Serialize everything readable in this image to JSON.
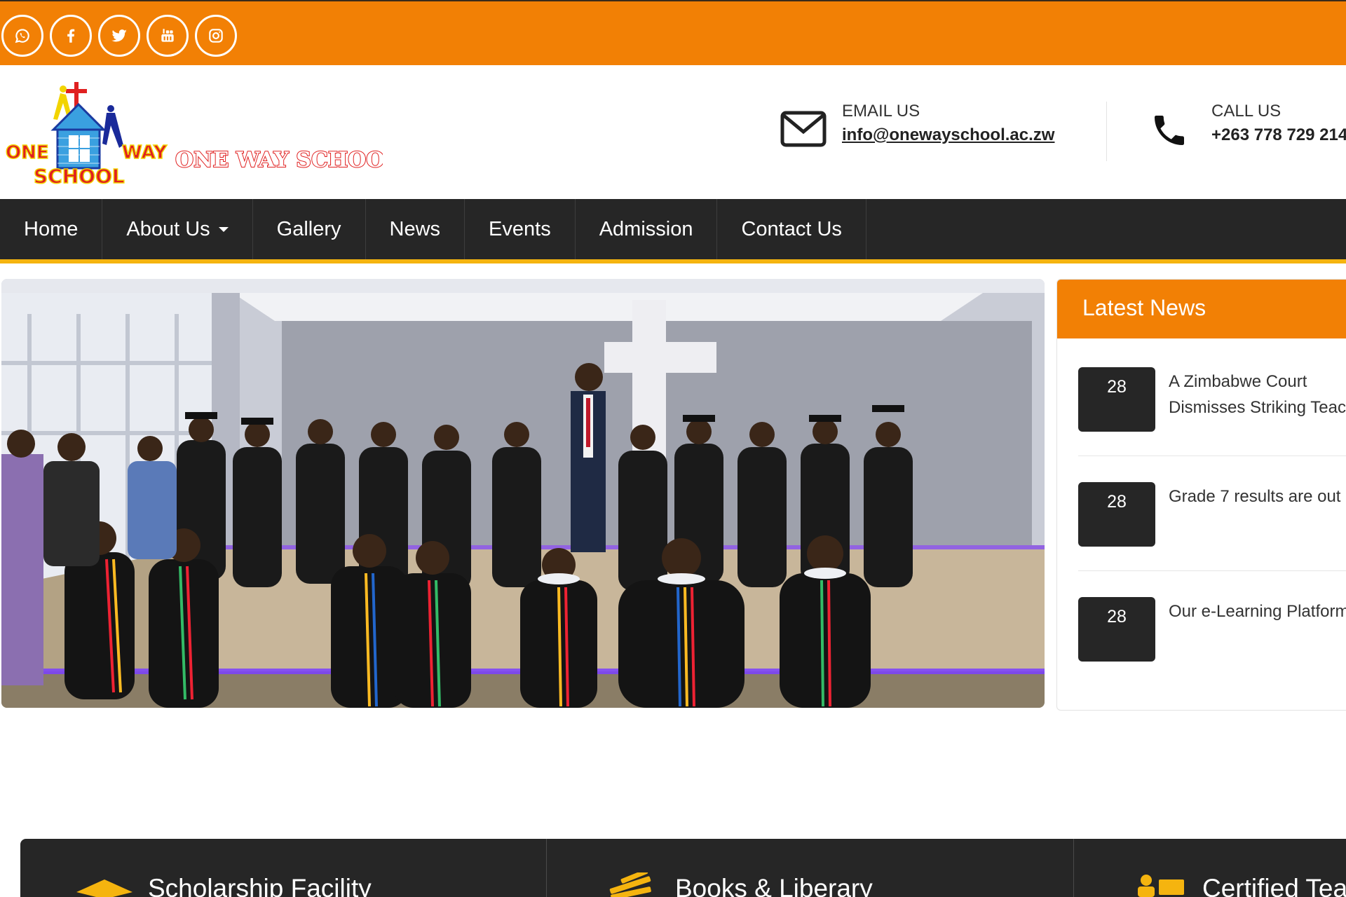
{
  "social": [
    {
      "name": "whatsapp"
    },
    {
      "name": "facebook"
    },
    {
      "name": "twitter"
    },
    {
      "name": "youtube"
    },
    {
      "name": "instagram"
    }
  ],
  "logo": {
    "badge_top": "ONE",
    "badge_right": "WAY",
    "badge_bottom": "SCHOOL",
    "wordmark": "ONE WAY SCHOOL"
  },
  "contact": {
    "email_label": "EMAIL US",
    "email_value": "info@onewayschool.ac.zw",
    "call_label": "CALL US",
    "call_value": "+263 778 729 214"
  },
  "nav": {
    "items": [
      "Home",
      "About Us",
      "Gallery",
      "News",
      "Events",
      "Admission",
      "Contact Us"
    ]
  },
  "news": {
    "heading": "Latest News",
    "items": [
      {
        "day": "28",
        "title": "A Zimbabwe Court Dismisses Striking Teachers"
      },
      {
        "day": "28",
        "title": "Grade 7 results are out"
      },
      {
        "day": "28",
        "title": "Our e-Learning Platform"
      }
    ]
  },
  "features": [
    {
      "label": "Scholarship Facility"
    },
    {
      "label": "Books & Liberary"
    },
    {
      "label": "Certified Teachers"
    }
  ],
  "colors": {
    "brand_orange": "#f28005",
    "nav_dark": "#262626",
    "nav_accent": "#f5b40f"
  }
}
